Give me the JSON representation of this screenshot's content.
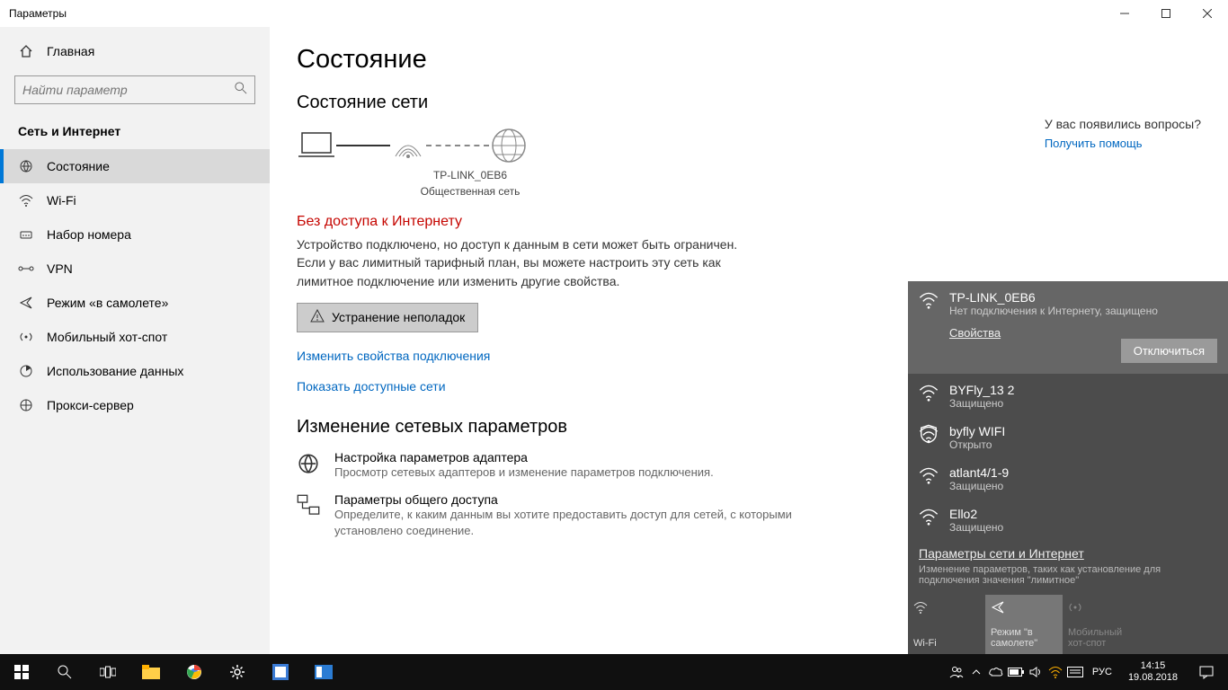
{
  "window": {
    "title": "Параметры"
  },
  "sidebar": {
    "home": "Главная",
    "search_placeholder": "Найти параметр",
    "section": "Сеть и Интернет",
    "items": [
      {
        "label": "Состояние",
        "icon": "status-icon",
        "active": true
      },
      {
        "label": "Wi-Fi",
        "icon": "wifi-icon",
        "active": false
      },
      {
        "label": "Набор номера",
        "icon": "dialup-icon",
        "active": false
      },
      {
        "label": "VPN",
        "icon": "vpn-icon",
        "active": false
      },
      {
        "label": "Режим «в самолете»",
        "icon": "airplane-icon",
        "active": false
      },
      {
        "label": "Мобильный хот-спот",
        "icon": "hotspot-icon",
        "active": false
      },
      {
        "label": "Использование данных",
        "icon": "data-icon",
        "active": false
      },
      {
        "label": "Прокси-сервер",
        "icon": "proxy-icon",
        "active": false
      }
    ]
  },
  "main": {
    "title": "Состояние",
    "subtitle": "Состояние сети",
    "diagram": {
      "network_name": "TP-LINK_0EB6",
      "network_type": "Общественная сеть"
    },
    "error_title": "Без доступа к Интернету",
    "error_body": "Устройство подключено, но доступ к данным в сети может быть ограничен. Если у вас лимитный тарифный план, вы можете настроить эту сеть как лимитное подключение или изменить другие свойства.",
    "troubleshoot_btn": "Устранение неполадок",
    "change_props_link": "Изменить свойства подключения",
    "show_networks_link": "Показать доступные сети",
    "change_params_title": "Изменение сетевых параметров",
    "adapter": {
      "title": "Настройка параметров адаптера",
      "desc": "Просмотр сетевых адаптеров и изменение параметров подключения."
    },
    "sharing": {
      "title": "Параметры общего доступа",
      "desc": "Определите, к каким данным вы хотите предоставить доступ для сетей, с которыми установлено соединение."
    }
  },
  "aside": {
    "questions": "У вас появились вопросы?",
    "help": "Получить помощь"
  },
  "flyout": {
    "selected": {
      "name": "TP-LINK_0EB6",
      "status": "Нет подключения к Интернету, защищено",
      "properties": "Свойства",
      "disconnect": "Отключиться"
    },
    "networks": [
      {
        "name": "BYFly_13 2",
        "status": "Защищено",
        "secured": true
      },
      {
        "name": "byfly WIFI",
        "status": "Открыто",
        "secured": false
      },
      {
        "name": "atlant4/1-9",
        "status": "Защищено",
        "secured": true
      },
      {
        "name": "Ello2",
        "status": "Защищено",
        "secured": true
      }
    ],
    "footer": {
      "link": "Параметры сети и Интернет",
      "desc": "Изменение параметров, таких как установление для подключения значения \"лимитное\""
    },
    "tiles": [
      {
        "label": "Wi-Fi",
        "icon": "wifi",
        "state": "on"
      },
      {
        "label": "Режим \"в самолете\"",
        "icon": "airplane",
        "state": "on"
      },
      {
        "label": "Мобильный хот-спот",
        "icon": "hotspot",
        "state": "off"
      }
    ]
  },
  "taskbar": {
    "lang": "РУС",
    "time": "14:15",
    "date": "19.08.2018"
  }
}
